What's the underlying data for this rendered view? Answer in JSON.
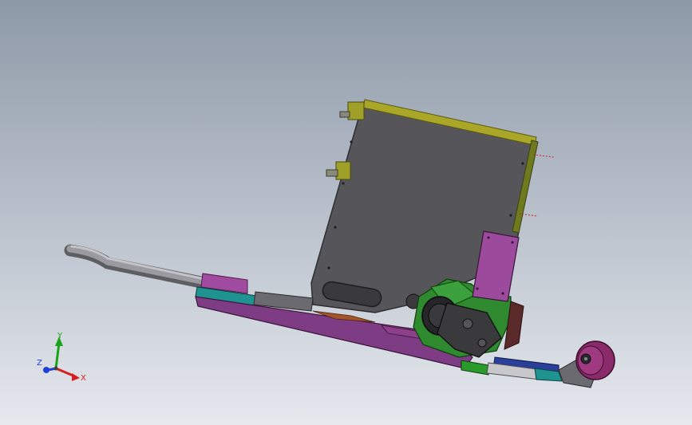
{
  "viewport": {
    "background_top": "#8e99a8",
    "background_bottom": "#e6e9ee"
  },
  "triad": {
    "x_label": "X",
    "y_label": "Y",
    "z_label": "Z",
    "x_color": "#d42020",
    "y_color": "#1aa31a",
    "z_color": "#1f3fd6"
  },
  "model": {
    "description_colors": {
      "plate": "#5a5a5c",
      "plate_edge": "#a8a82a",
      "base_purple": "#8a3f8a",
      "base_teal": "#1d8f8c",
      "hose": "#7d7d80",
      "bracket_green": "#2a8a2a",
      "magenta_plate": "#9a4a9a",
      "motor": "#2a2a2a",
      "arm_blue": "#2a3f9a",
      "wheel": "#8a2a6a"
    }
  }
}
